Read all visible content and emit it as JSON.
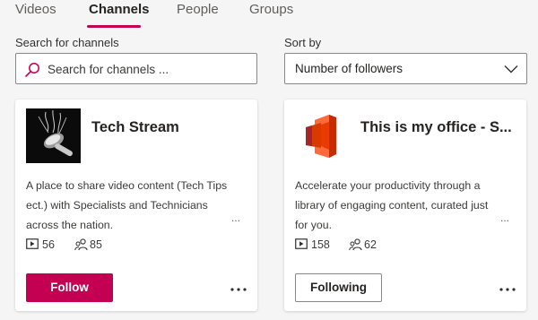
{
  "tabs": [
    {
      "label": "Videos",
      "active": false
    },
    {
      "label": "Channels",
      "active": true
    },
    {
      "label": "People",
      "active": false
    },
    {
      "label": "Groups",
      "active": false
    }
  ],
  "search": {
    "label": "Search for channels",
    "placeholder": "Search for channels ...",
    "value": ""
  },
  "sort": {
    "label": "Sort by",
    "selected": "Number of followers"
  },
  "colors": {
    "accent": "#c30052",
    "text": "#252423",
    "border": "#8a8886"
  },
  "channels": [
    {
      "title": "Tech Stream",
      "description": "A place to share video content (Tech Tips ect.) with Specialists and Technicians across the nation.",
      "more_indicator": "...",
      "video_count": "56",
      "follower_count": "85",
      "button_label": "Follow",
      "button_style": "primary",
      "thumbnail": "microphone-image"
    },
    {
      "title": "This is my office - S...",
      "description": "Accelerate your productivity through a library of engaging content, curated just for you.",
      "more_indicator": "...",
      "video_count": "158",
      "follower_count": "62",
      "button_label": "Following",
      "button_style": "secondary",
      "thumbnail": "office-logo"
    }
  ],
  "icons": {
    "search": "search-icon",
    "chevron": "chevron-down-icon",
    "video": "video-icon",
    "followers": "people-icon",
    "more": "more-options-icon"
  }
}
